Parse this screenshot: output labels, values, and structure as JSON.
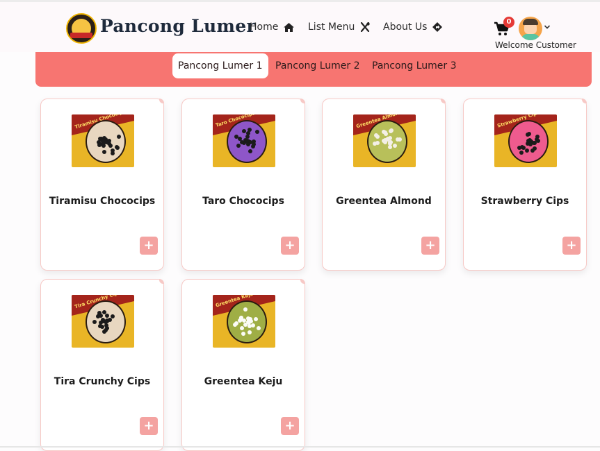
{
  "header": {
    "brand": "Pancong Lumer",
    "nav": [
      {
        "label": "Home",
        "icon": "home-icon"
      },
      {
        "label": "List Menu",
        "icon": "utensils-icon"
      },
      {
        "label": "About Us",
        "icon": "direction-icon"
      }
    ],
    "cart_count": "0",
    "welcome": "Welcome Customer"
  },
  "tabs": [
    {
      "label": "Pancong Lumer 1",
      "active": true
    },
    {
      "label": "Pancong Lumer 2",
      "active": false
    },
    {
      "label": "Pancong Lumer 3",
      "active": false
    }
  ],
  "products": [
    {
      "name": "Tiramisu Chococips",
      "image_text": "Tiramisu Chococips",
      "topping": "#1b1b1b",
      "base": "#e8d7c0"
    },
    {
      "name": "Taro Chococips",
      "image_text": "Taro Chococips",
      "topping": "#1b1b1b",
      "base": "#8e56c8"
    },
    {
      "name": "Greentea Almond",
      "image_text": "Greentea Almond",
      "topping": "#f3efe6",
      "base": "#b8c05a"
    },
    {
      "name": "Strawberry Cips",
      "image_text": "Strawberry Cips",
      "topping": "#1b1b1b",
      "base": "#ee5b8e"
    },
    {
      "name": "Tira Crunchy Cips",
      "image_text": "Tira Crunchy Cips",
      "topping": "#1b1b1b",
      "base": "#e8d7c0"
    },
    {
      "name": "Greentea Keju",
      "image_text": "Greentea Keju",
      "topping": "#fbfbf6",
      "base": "#9fae45"
    }
  ],
  "add_label": "+",
  "colors": {
    "accent": "#f77571",
    "add_button": "#f4a3a1",
    "brand_text": "#1e2a3b"
  }
}
